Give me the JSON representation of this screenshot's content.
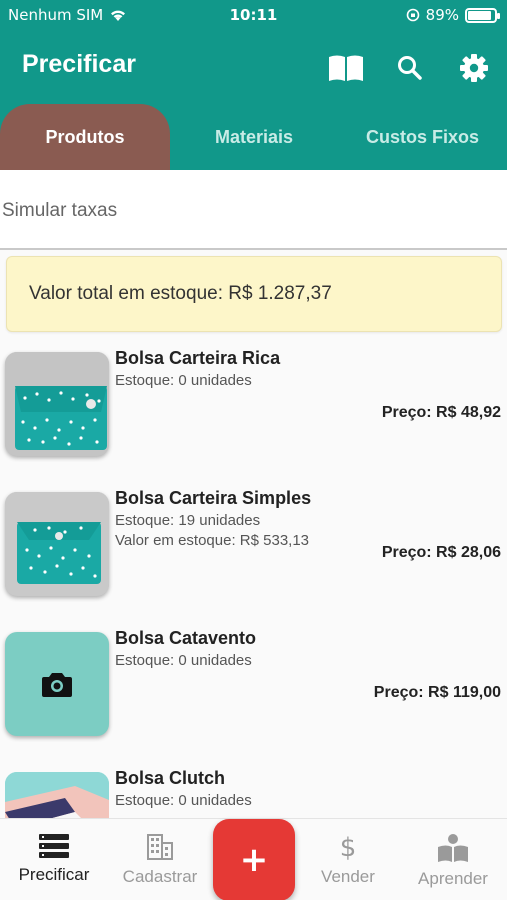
{
  "status_bar": {
    "carrier": "Nenhum SIM",
    "time": "10:11",
    "battery": "89%",
    "battery_level": 0.89
  },
  "app_bar": {
    "title": "Precificar",
    "icons": [
      "book-icon",
      "search-icon",
      "gear-icon"
    ]
  },
  "tabs": [
    {
      "label": "Produtos",
      "active": true
    },
    {
      "label": "Materiais",
      "active": false
    },
    {
      "label": "Custos Fixos",
      "active": false
    }
  ],
  "simulate": {
    "label": "Simular taxas"
  },
  "summary": {
    "total_stock_text": "Valor total em estoque: R$ 1.287,37"
  },
  "products": [
    {
      "name": "Bolsa Carteira Rica",
      "stock": "Estoque: 0 unidades",
      "value": "",
      "price": "Preço: R$ 48,92"
    },
    {
      "name": "Bolsa Carteira Simples",
      "stock": "Estoque: 19 unidades",
      "value": "Valor em estoque: R$ 533,13",
      "price": "Preço: R$ 28,06"
    },
    {
      "name": "Bolsa Catavento",
      "stock": "Estoque: 0 unidades",
      "value": "",
      "price": "Preço: R$ 119,00"
    },
    {
      "name": "Bolsa Clutch",
      "stock": "Estoque: 0 unidades",
      "value": "",
      "price": ""
    }
  ],
  "bottom_nav": [
    {
      "label": "Precificar",
      "icon": "list-icon",
      "active": true
    },
    {
      "label": "Cadastrar",
      "icon": "building-icon",
      "active": false
    },
    {
      "label": "+",
      "icon": "add-icon"
    },
    {
      "label": "Vender",
      "icon": "dollar-icon",
      "active": false
    },
    {
      "label": "Aprender",
      "icon": "reader-icon",
      "active": false
    }
  ],
  "colors": {
    "primary": "#11988a",
    "active_tab": "#8a5b51",
    "summary_bg": "#fdf6c9",
    "fab": "#e53935",
    "camera_thumb": "#7ccdc3"
  }
}
